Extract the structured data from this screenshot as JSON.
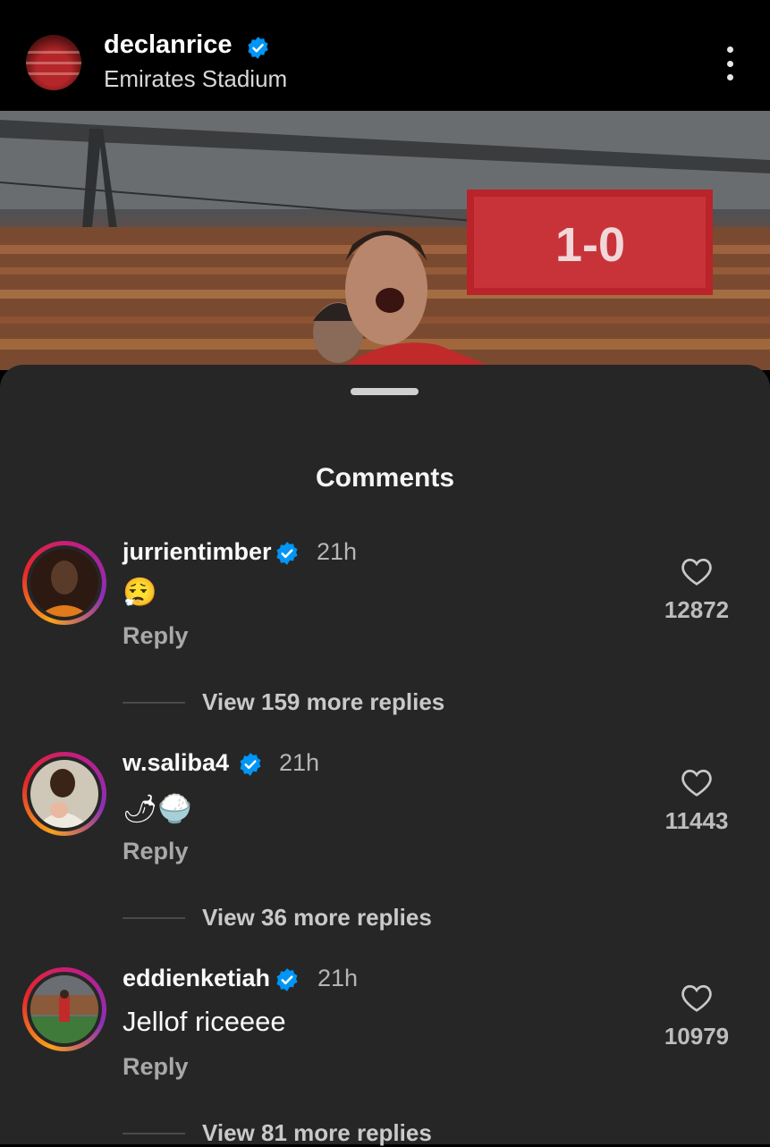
{
  "post": {
    "username": "declanrice",
    "location": "Emirates Stadium",
    "scoreboard_text": "1-0"
  },
  "sheet": {
    "title": "Comments"
  },
  "comments": [
    {
      "username": "jurrientimber",
      "time": "21h",
      "text": "😮‍💨",
      "reply_label": "Reply",
      "likes": "12872",
      "more_replies": "View 159 more replies"
    },
    {
      "username": "w.saliba4",
      "time": "21h",
      "text": "🌶🍚",
      "reply_label": "Reply",
      "likes": "11443",
      "more_replies": "View 36 more replies"
    },
    {
      "username": "eddienketiah",
      "time": "21h",
      "text": "Jellof riceeee",
      "reply_label": "Reply",
      "likes": "10979",
      "more_replies": "View 81 more replies"
    }
  ],
  "colors": {
    "verified": "#0095f6",
    "sheet_bg": "#262626",
    "brand_red": "#e0222a"
  }
}
